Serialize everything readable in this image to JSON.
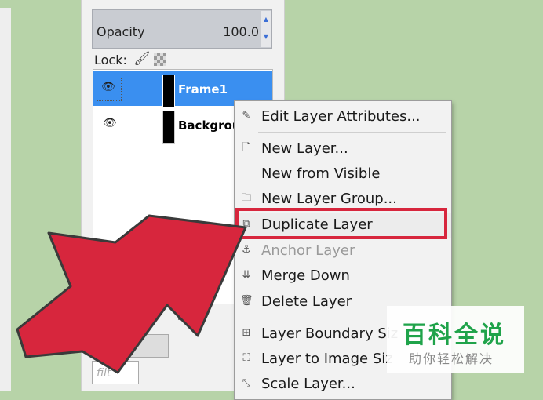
{
  "panel": {
    "opacity_label": "Opacity",
    "opacity_value": "100.0",
    "lock_label": "Lock:",
    "layers": [
      {
        "name": "Frame1",
        "selected": true
      },
      {
        "name": "Backgrou",
        "selected": false
      }
    ],
    "filter_placeholder": "filt"
  },
  "menu": {
    "items": [
      {
        "label": "Edit Layer Attributes...",
        "icon": "edit-icon",
        "enabled": true
      },
      {
        "label": "New Layer...",
        "icon": "new-page-icon",
        "enabled": true
      },
      {
        "label": "New from Visible",
        "icon": "",
        "enabled": true
      },
      {
        "label": "New Layer Group...",
        "icon": "folder-icon",
        "enabled": true
      },
      {
        "label": "Duplicate Layer",
        "icon": "duplicate-icon",
        "enabled": true
      },
      {
        "label": "Anchor Layer",
        "icon": "anchor-icon",
        "enabled": false
      },
      {
        "label": "Merge Down",
        "icon": "merge-down-icon",
        "enabled": true
      },
      {
        "label": "Delete Layer",
        "icon": "trash-icon",
        "enabled": true
      },
      {
        "label": "Layer Boundary Siz",
        "icon": "boundary-icon",
        "enabled": true
      },
      {
        "label": "Layer to Image Siz",
        "icon": "fit-icon",
        "enabled": true
      },
      {
        "label": "Scale Layer...",
        "icon": "scale-icon",
        "enabled": true
      }
    ],
    "highlighted": "Duplicate Layer"
  },
  "watermark": {
    "title": "百科全说",
    "subtitle": "助你轻松解决"
  },
  "colors": {
    "background": "#b7d3a8",
    "selection": "#3a8ff0",
    "highlight_box": "#d7263d",
    "arrow": "#d7263d",
    "watermark_green": "#1fa34a"
  }
}
